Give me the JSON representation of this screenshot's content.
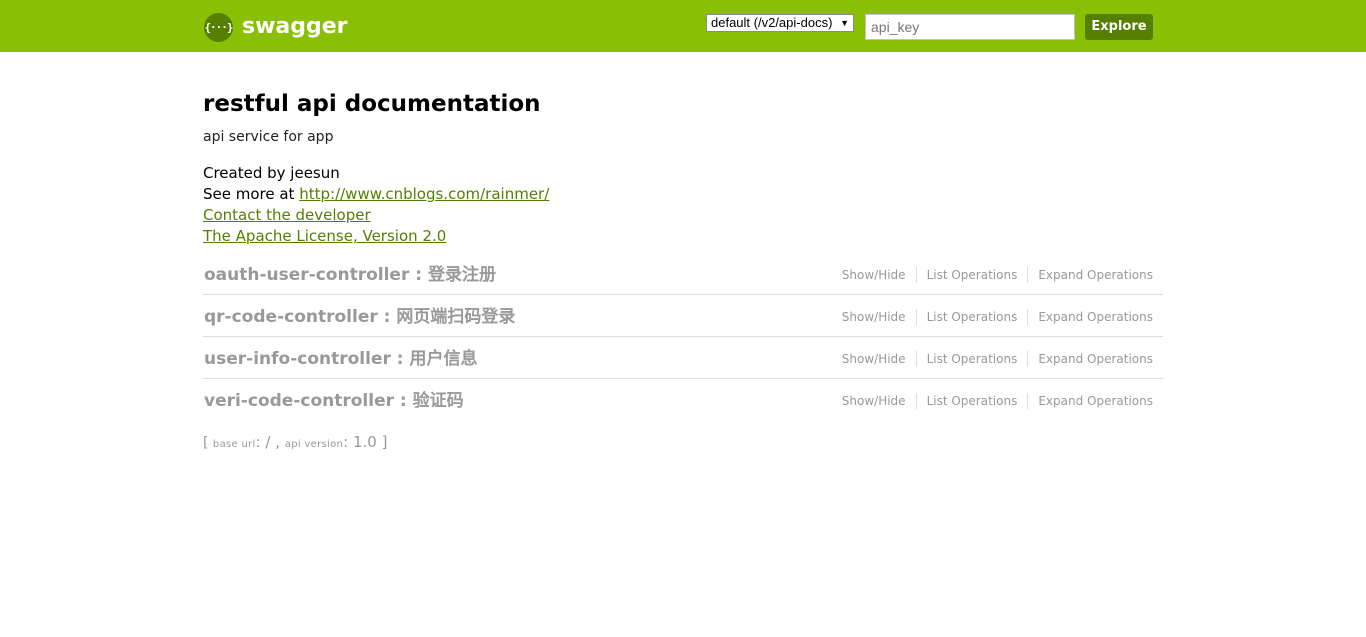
{
  "header": {
    "logo_icon_glyph": "{···}",
    "logo_text": "swagger",
    "spec_select_value": "default (/v2/api-docs)",
    "api_key_placeholder": "api_key",
    "explore_label": "Explore",
    "colors": {
      "header_bg": "#89bf04",
      "accent": "#547f00"
    }
  },
  "info": {
    "title": "restful api documentation",
    "description": "api service for app",
    "created_by": "Created by jeesun",
    "see_more_prefix": "See more at ",
    "see_more_link": "http://www.cnblogs.com/rainmer/",
    "contact_link": "Contact the developer",
    "license_link": "The Apache License, Version 2.0"
  },
  "resources": [
    {
      "name": "oauth-user-controller : 登录注册",
      "ops": [
        "Show/Hide",
        "List Operations",
        "Expand Operations"
      ]
    },
    {
      "name": "qr-code-controller : 网页端扫码登录",
      "ops": [
        "Show/Hide",
        "List Operations",
        "Expand Operations"
      ]
    },
    {
      "name": "user-info-controller : 用户信息",
      "ops": [
        "Show/Hide",
        "List Operations",
        "Expand Operations"
      ]
    },
    {
      "name": "veri-code-controller : 验证码",
      "ops": [
        "Show/Hide",
        "List Operations",
        "Expand Operations"
      ]
    }
  ],
  "footer": {
    "open_bracket": "[ ",
    "base_url_label": "base url",
    "base_url_value": ": / , ",
    "api_version_label": "api version",
    "api_version_value": ": 1.0 ]"
  }
}
